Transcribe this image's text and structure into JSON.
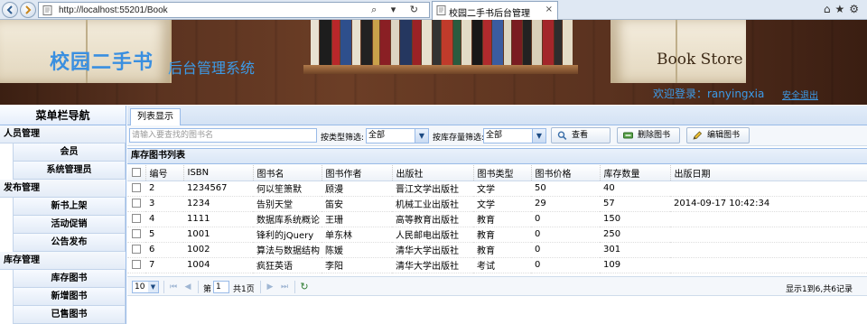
{
  "browser": {
    "url": "http://localhost:55201/Book",
    "tab_title": "校园二手书后台管理",
    "address_tools": "⌕ ▾ ↻",
    "tab_close": "×",
    "right_tools": "⌂★⚙"
  },
  "header": {
    "site_title": "校园二手书",
    "site_subtitle": "后台管理系统",
    "store_label": "Book Store",
    "welcome": "欢迎登录：ranyingxia",
    "logout": "安全退出"
  },
  "sidebar": {
    "title": "菜单栏导航",
    "groups": [
      {
        "title": "人员管理",
        "items": [
          "会员",
          "系统管理员"
        ]
      },
      {
        "title": "发布管理",
        "items": [
          "新书上架",
          "活动促销",
          "公告发布"
        ]
      },
      {
        "title": "库存管理",
        "items": [
          "库存图书",
          "新增图书",
          "已售图书"
        ]
      }
    ]
  },
  "tabs": {
    "active": "列表显示"
  },
  "toolbar": {
    "search_placeholder": "请输入要查找的图书名",
    "type_filter_label": "按类型筛选:",
    "type_filter_value": "全部",
    "stock_filter_label": "按库存量筛选:",
    "stock_filter_value": "全部",
    "view_button": "查看",
    "delete_button": "删除图书",
    "edit_button": "编辑图书"
  },
  "grid": {
    "title": "库存图书列表",
    "columns": [
      "编号",
      "ISBN",
      "图书名",
      "图书作者",
      "出版社",
      "图书类型",
      "图书价格",
      "库存数量",
      "出版日期"
    ],
    "rows": [
      [
        "2",
        "1234567",
        "何以笙箫默",
        "顾漫",
        "晋江文学出版社",
        "文学",
        "50",
        "40",
        ""
      ],
      [
        "3",
        "1234",
        "告别天堂",
        "笛安",
        "机械工业出版社",
        "文学",
        "29",
        "57",
        "2014-09-17 10:42:34"
      ],
      [
        "4",
        "1111",
        "数据库系统概论",
        "王珊",
        "高等教育出版社",
        "教育",
        "0",
        "150",
        ""
      ],
      [
        "5",
        "1001",
        "锋利的jQuery",
        "单东林",
        "人民邮电出版社",
        "教育",
        "0",
        "250",
        ""
      ],
      [
        "6",
        "1002",
        "算法与数据结构",
        "陈媛",
        "清华大学出版社",
        "教育",
        "0",
        "301",
        ""
      ],
      [
        "7",
        "1004",
        "疯狂英语",
        "李阳",
        "清华大学出版社",
        "考试",
        "0",
        "109",
        ""
      ]
    ]
  },
  "pager": {
    "page_size": "10",
    "page_label_before": "第",
    "page_number": "1",
    "page_label_after": "共1页",
    "info": "显示1到6,共6记录"
  }
}
